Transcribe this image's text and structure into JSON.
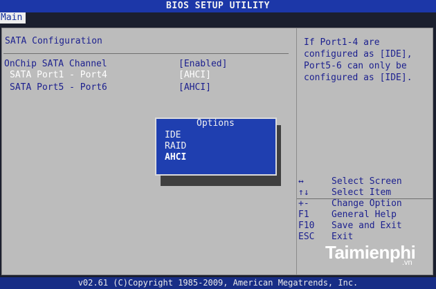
{
  "app": {
    "title": "BIOS SETUP UTILITY",
    "tab_label": "Main"
  },
  "main": {
    "section_title": "SATA Configuration",
    "settings": [
      {
        "label": "OnChip SATA Channel",
        "value": "[Enabled]"
      },
      {
        "label": "SATA Port1 - Port4",
        "value": "[AHCI]"
      },
      {
        "label": "SATA Port5 - Port6",
        "value": "[AHCI]"
      }
    ]
  },
  "popup": {
    "title": "Options",
    "options": [
      "IDE",
      "RAID",
      "AHCI"
    ],
    "selected": "AHCI"
  },
  "help": {
    "text": "If Port1-4 are\nconfigured as [IDE],\nPort5-6 can only be\nconfigured as [IDE].",
    "keys": [
      {
        "key": "↔",
        "desc": "Select Screen"
      },
      {
        "key": "↑↓",
        "desc": "Select Item"
      },
      {
        "key": "+-",
        "desc": "Change Option"
      },
      {
        "key": "F1",
        "desc": "General Help"
      },
      {
        "key": "F10",
        "desc": "Save and Exit"
      },
      {
        "key": "ESC",
        "desc": "Exit"
      }
    ]
  },
  "footer": {
    "text": "v02.61 (C)Copyright 1985-2009, American Megatrends, Inc."
  },
  "watermark": {
    "brand": "Taimienphi",
    "suffix": ".vn"
  },
  "colors": {
    "bios_blue": "#1c37a8",
    "panel_gray": "#bcbcbc",
    "text_blue": "#1b1f8e",
    "popup_blue": "#1f3fb0",
    "white": "#ffffff"
  }
}
